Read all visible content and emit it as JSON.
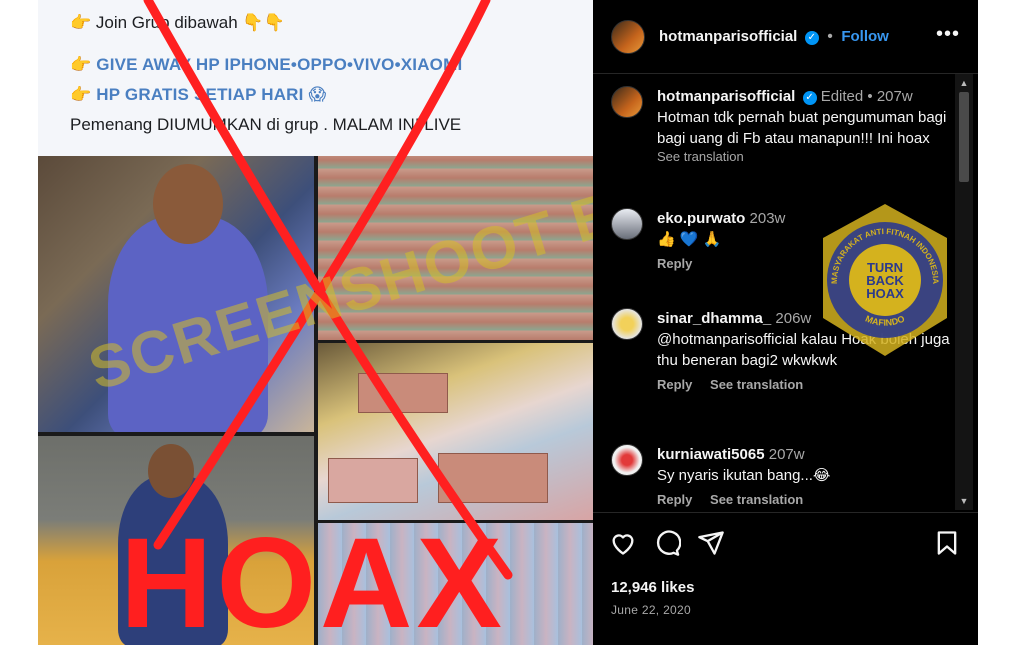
{
  "post_image": {
    "fb_lines": [
      "👉 Join Grup dibawah 👇👇",
      "👉 GIVE AWAY HP IPHONE•OPPO•VIVO•XIAOMI",
      "👉 HP GRATIS SETIAP HARI 😱",
      "Pemenang DIUMUMKAN di grup . MALAM INI LIVE"
    ],
    "hoax_stamp": "HOAX",
    "watermark": "SCREENSHOOT BY"
  },
  "header": {
    "username": "hotmanparisofficial",
    "follow_label": "Follow",
    "more_label": "•••"
  },
  "caption": {
    "username": "hotmanparisofficial",
    "edited": "Edited",
    "time": "207w",
    "text": "Hotman tdk pernah buat pengumuman bagi bagi uang di Fb atau manapun!!! Ini hoax",
    "see_translation": "See translation"
  },
  "comments": [
    {
      "username": "eko.purwato",
      "time": "203w",
      "text": "👍 💙 🙏",
      "reply": "Reply",
      "see_translation": ""
    },
    {
      "username": "sinar_dhamma_",
      "time": "206w",
      "text": "@hotmanparisofficial kalau Hoak boleh juga thu beneran bagi2 wkwkwk",
      "reply": "Reply",
      "see_translation": "See translation"
    },
    {
      "username": "kurniawati5065",
      "time": "207w",
      "text": "Sy nyaris ikutan bang...😂",
      "reply": "Reply",
      "see_translation": "See translation"
    }
  ],
  "actions": {
    "likes": "12,946 likes",
    "date": "June 22, 2020"
  },
  "badge": {
    "arc_top": "MASYARAKAT ANTI FITNAH INDONESIA",
    "arc_bottom": "MAFINDO",
    "line1": "TURN",
    "line2": "BACK",
    "line3": "HOAX"
  },
  "colors": {
    "accent": "#0095f6",
    "hoax_red": "#ff1f1f",
    "badge_blue": "#2c3a8c",
    "badge_gold": "#d4b21e"
  }
}
